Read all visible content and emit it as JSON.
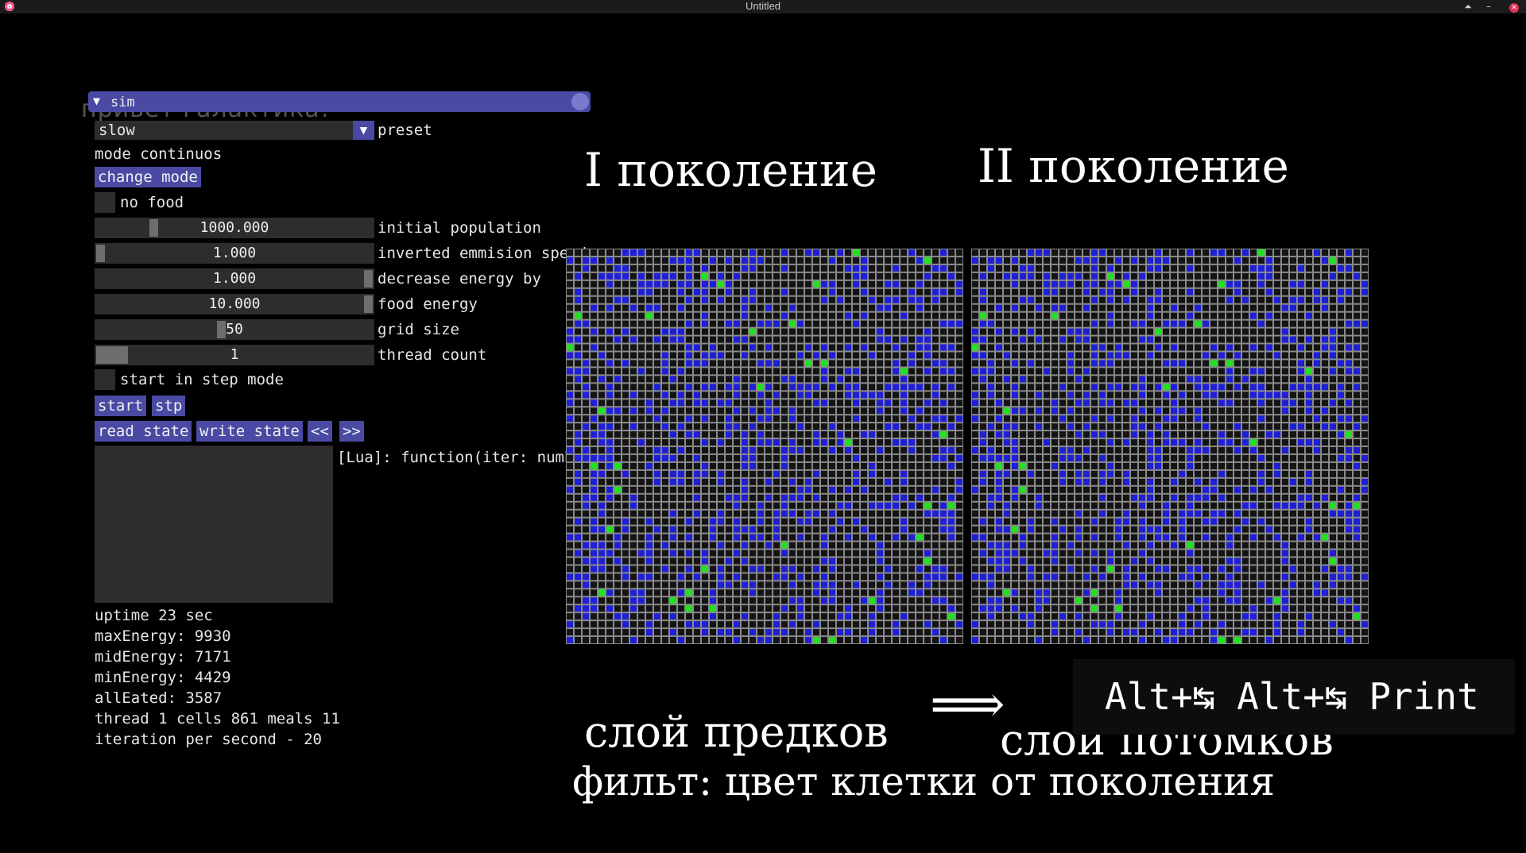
{
  "window": {
    "title": "Untitled"
  },
  "ghost_text": "привет галактика!",
  "sim": {
    "header": "sim",
    "preset": {
      "value": "slow",
      "label": "preset"
    },
    "mode_text": "mode continuos",
    "change_mode_label": "change mode",
    "no_food_label": "no food",
    "sliders": [
      {
        "value": "1000.000",
        "label": "initial population",
        "fraction": 0.2
      },
      {
        "value": "1.000",
        "label": "inverted emmision speed",
        "fraction": 0.0
      },
      {
        "value": "1.000",
        "label": "decrease energy by",
        "fraction": 1.0
      },
      {
        "value": "10.000",
        "label": "food energy",
        "fraction": 1.0
      },
      {
        "value": "50",
        "label": "grid size",
        "fraction": 0.45
      },
      {
        "value": "1",
        "label": "thread count",
        "fraction": 0.0
      }
    ],
    "step_mode_label": "start in step mode",
    "start_label": "start",
    "stp_label": "stp",
    "read_state_label": "read state",
    "write_state_label": "write state",
    "prev_label": "<<",
    "next_label": ">>",
    "lua_label": "[Lua]: function(iter: number",
    "stats": [
      "uptime 23 sec",
      "maxEnergy: 9930",
      "midEnergy: 7171",
      "minEnergy: 4429",
      "allEated: 3587",
      "thread 1 cells 861 meals 11",
      "iteration per second - 20"
    ]
  },
  "annotations": {
    "gen1": "I поколение",
    "gen2": "II поколение",
    "layer_ancestors": "слой предков",
    "arrow": "⟹",
    "layer_descendants": "слой потомков",
    "filter": "фильт: цвет клетки от поколения"
  },
  "shortcut": "Alt+↹ Alt+↹ Print",
  "colors": {
    "background": "#000000",
    "accent": "#4a4aa4",
    "frame": "#2d2d2d",
    "grid_line": "#8a8a8a",
    "cell_empty": "#141414",
    "cell_blue": "#1f1fd6",
    "cell_green": "#22e022"
  },
  "grid": {
    "size": 50
  }
}
